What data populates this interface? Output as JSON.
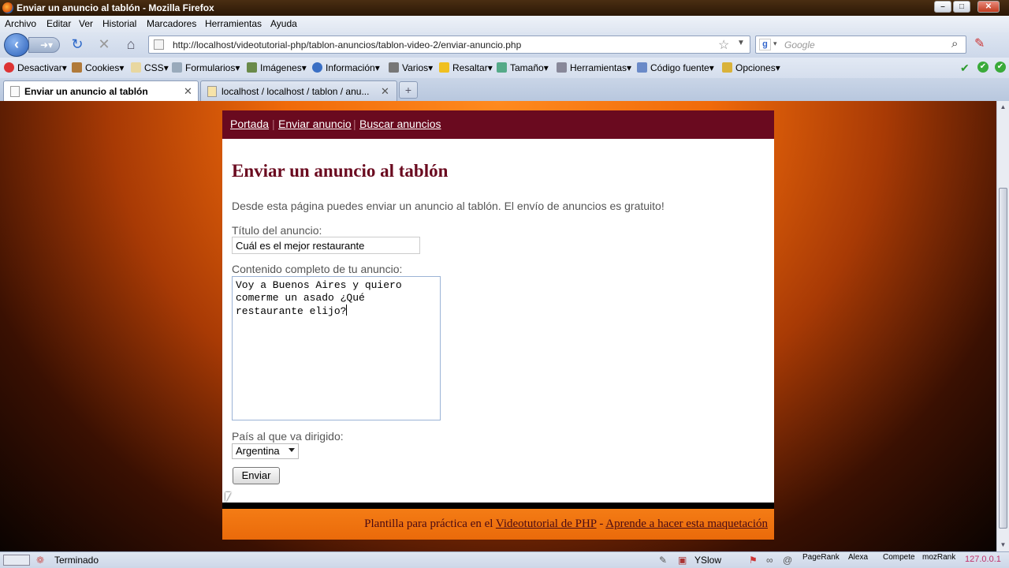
{
  "window": {
    "title": "Enviar un anuncio al tablón - Mozilla Firefox"
  },
  "menu": [
    "Archivo",
    "Editar",
    "Ver",
    "Historial",
    "Marcadores",
    "Herramientas",
    "Ayuda"
  ],
  "address": {
    "url": "http://localhost/videotutorial-php/tablon-anuncios/tablon-video-2/enviar-anuncio.php"
  },
  "search": {
    "placeholder": "Google"
  },
  "webdev_toolbar": [
    "Desactivar",
    "Cookies",
    "CSS",
    "Formularios",
    "Imágenes",
    "Información",
    "Varios",
    "Resaltar",
    "Tamaño",
    "Herramientas",
    "Código fuente",
    "Opciones"
  ],
  "tabs": [
    {
      "label": "Enviar un anuncio al tablón"
    },
    {
      "label": "localhost / localhost / tablon / anu..."
    }
  ],
  "site_nav": [
    "Portada",
    "Enviar anuncio",
    "Buscar anuncios"
  ],
  "page": {
    "heading": "Enviar un anuncio al tablón",
    "intro": "Desde esta página puedes enviar un anuncio al tablón. El envío de anuncios es gratuito!",
    "title_label": "Título del anuncio:",
    "title_value": "Cuál es el mejor restaurante",
    "content_label": "Contenido completo de tu anuncio:",
    "content_value": "Voy a Buenos Aires y quiero\ncomerme un asado ¿Qué\nrestaurante elijo?",
    "country_label": "País al que va dirigido:",
    "country_value": "Argentina",
    "submit_label": "Enviar"
  },
  "footer": {
    "prefix": "Plantilla para práctica en el ",
    "link1": "Videotutorial de PHP",
    "separator": " - ",
    "link2": "Aprende a hacer esta maquetación"
  },
  "status": {
    "text": "Terminado",
    "yslow": "YSlow",
    "pagerank": "PageRank",
    "alexa": "Alexa",
    "compete": "Compete",
    "mozrank": "mozRank",
    "ip": "127.0.0.1"
  },
  "colors": {
    "site_nav_bg": "#6a0a1f",
    "heading": "#6a0a1f",
    "footer_bg": "#f47c15"
  }
}
